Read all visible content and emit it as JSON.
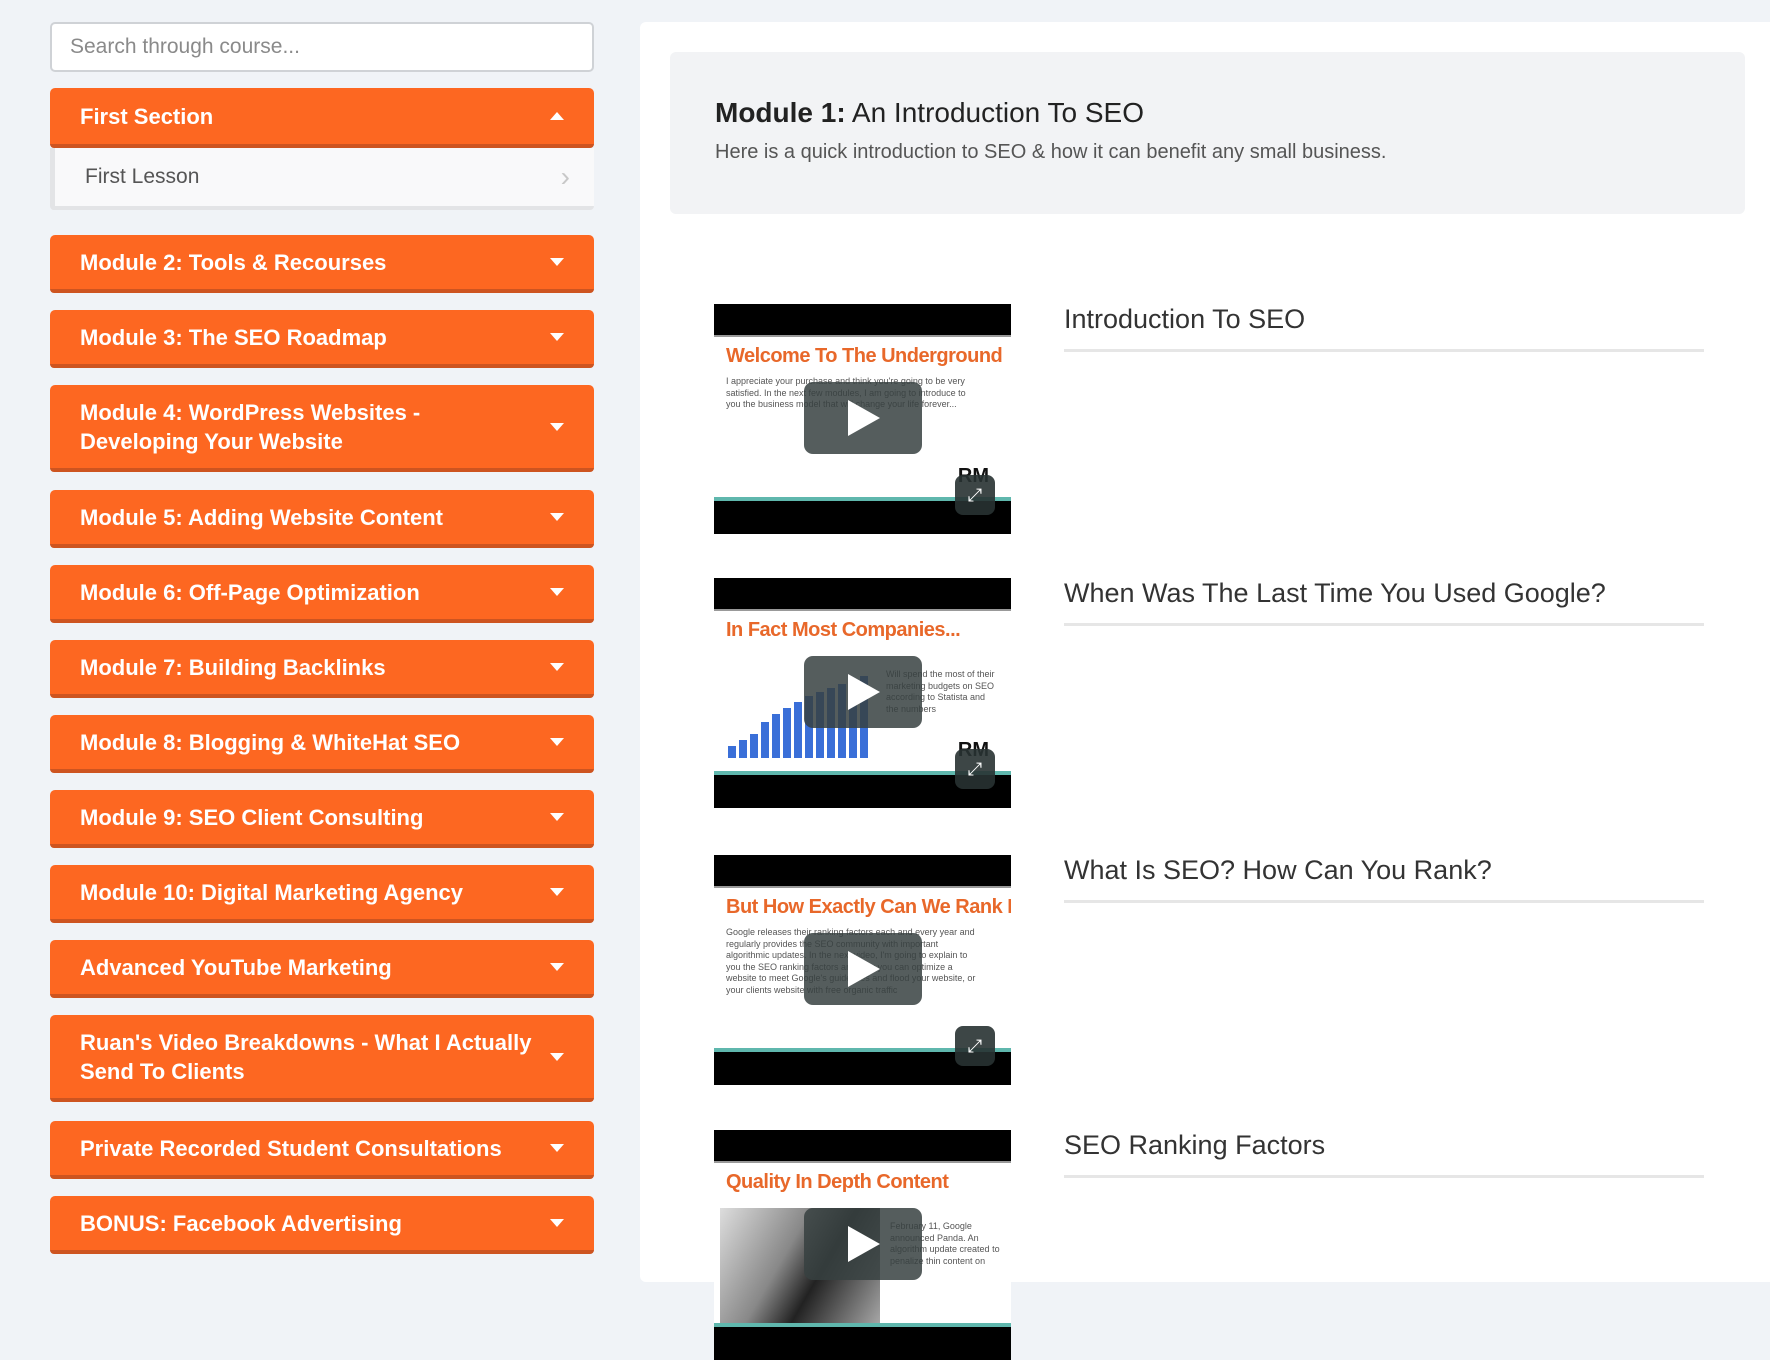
{
  "search": {
    "placeholder": "Search through course..."
  },
  "sections": [
    {
      "label": "First Section",
      "expanded": true,
      "lessons": [
        {
          "label": "First Lesson"
        }
      ]
    },
    {
      "label": "Module 2: Tools & Recourses"
    },
    {
      "label": "Module 3: The SEO Roadmap"
    },
    {
      "label": "Module 4: WordPress Websites - Developing Your Website"
    },
    {
      "label": "Module 5: Adding Website Content"
    },
    {
      "label": "Module 6: Off-Page Optimization"
    },
    {
      "label": "Module 7: Building Backlinks"
    },
    {
      "label": "Module 8: Blogging & WhiteHat SEO"
    },
    {
      "label": "Module 9: SEO Client Consulting"
    },
    {
      "label": "Module 10: Digital Marketing Agency"
    },
    {
      "label": "Advanced YouTube Marketing"
    },
    {
      "label": "Ruan's Video Breakdowns - What I Actually Send To Clients"
    },
    {
      "label": "Private Recorded Student Consultations"
    },
    {
      "label": "BONUS: Facebook Advertising"
    }
  ],
  "module": {
    "prefix": "Module 1:",
    "title": "An Introduction To SEO",
    "description": "Here is a quick introduction to SEO & how it can benefit any small business."
  },
  "videos": [
    {
      "title": "Introduction To SEO",
      "slide_title": "Welcome To The Underground",
      "slide_body": "I appreciate your purchase and think you're going to be very satisfied. In the next few modules, I am going to introduce to you the business model that will change your life forever..."
    },
    {
      "title": "When Was The Last Time You Used Google?",
      "slide_title": "In Fact Most Companies...",
      "slide_body": "Will spend the most of their marketing budgets on SEO according to Statista and the numbers"
    },
    {
      "title": "What Is SEO? How Can You Rank?",
      "slide_title": "But How Exactly Can We Rank In Google?",
      "slide_body": "Google releases their ranking factors each and every year and regularly provides the SEO community with important algorithmic updates. In the next video, I'm going to explain to you the SEO ranking factors and how you can optimize a website to meet Google's guidelines and flood your website, or your clients website with free organic traffic"
    },
    {
      "title": "SEO Ranking Factors",
      "slide_title": "Quality In Depth Content",
      "slide_body": "February 11, Google announced Panda. An algorithm update created to penalize thin content on"
    }
  ],
  "logo_text": "RM",
  "colors": {
    "accent": "#fd6721",
    "accent_dark": "#cd5420",
    "slide_title": "#e8682a",
    "background": "#f0f3f7"
  }
}
